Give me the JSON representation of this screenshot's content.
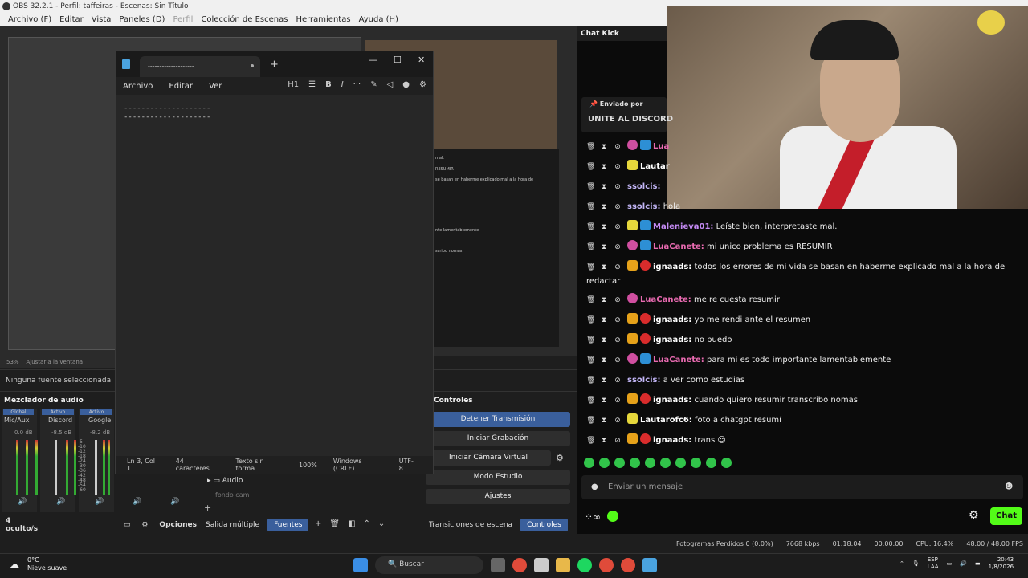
{
  "titlebar": {
    "title": "OBS 32.2.1 - Perfil: taffeiras - Escenas: Sin Título"
  },
  "menu": [
    "Archivo (F)",
    "Editar",
    "Vista",
    "Paneles (D)",
    "Perfil",
    "Colección de Escenas",
    "Herramientas",
    "Ayuda (H)"
  ],
  "notepad": {
    "tab_title": "--------------------",
    "menus": [
      "Archivo",
      "Editar",
      "Ver"
    ],
    "heading_label": "H1",
    "lines": [
      "--------------------",
      "--------------------"
    ],
    "status": [
      "Ln 3, Col 1",
      "44 caracteres.",
      "Texto sin forma",
      "100%",
      "Windows (CRLF)",
      "UTF-8"
    ]
  },
  "preview": {
    "zoom": "53%",
    "fit": "Ajustar a la ventana",
    "chat_lines": [
      "mal.",
      "RESUMIR",
      "se basan en haberme explicado mal a la hora de",
      "nte lamentablemente",
      "scribo nomas"
    ]
  },
  "sources": {
    "none_selected": "Ninguna fuente seleccionada"
  },
  "mixer": {
    "title": "Mezclador de audio",
    "channels": [
      {
        "status": "Global",
        "name": "Mic/Aux",
        "db": "0.0 dB"
      },
      {
        "status": "Activo",
        "name": "Discord",
        "db": "-8.5 dB"
      },
      {
        "status": "Activo",
        "name": "Google",
        "db": "-8.2 dB"
      }
    ],
    "scale": [
      "-5",
      "-10",
      "-12",
      "-18",
      "-24",
      "-30",
      "-36",
      "-42",
      "-48",
      "-54",
      "-60"
    ],
    "hidden": "4 oculto/s",
    "options": "Opciones",
    "sources_list": [
      "Audio",
      "fondo cam"
    ]
  },
  "controls": {
    "title": "Controles",
    "buttons": [
      "Detener Transmisión",
      "Iniciar Grabación",
      "Iniciar Cámara Virtual",
      "Modo Estudio",
      "Ajustes"
    ]
  },
  "dock_tabs": [
    "Salida múltiple",
    "Fuentes",
    "Transiciones de escena",
    "Controles"
  ],
  "chat": {
    "title": "Chat Kick",
    "pinned_by": "Enviado por",
    "pinned_msg": "UNITE AL DISCORD",
    "messages": [
      {
        "user": "Lua",
        "text": "",
        "color": "#e86ab0",
        "badges": [
          "b28",
          "bk"
        ]
      },
      {
        "user": "Lautar",
        "text": "",
        "color": "#ffffff",
        "badges": [
          "b15"
        ]
      },
      {
        "user": "ssolcis:",
        "text": "",
        "color": "#c3b6f7",
        "badges": []
      },
      {
        "user": "ssolcis:",
        "text": "hola",
        "color": "#c3b6f7",
        "badges": []
      },
      {
        "user": "Malenieva01:",
        "text": "Leíste bien, interpretaste mal.",
        "color": "#c58bf5",
        "badges": [
          "b15",
          "bk"
        ]
      },
      {
        "user": "LuaCanete:",
        "text": "mi unico problema es RESUMIR",
        "color": "#e86ab0",
        "badges": [
          "b28",
          "bk"
        ]
      },
      {
        "user": "ignaads:",
        "text": "todos los errores de mi vida se basan en haberme explicado mal a la hora de redactar",
        "color": "#ffffff",
        "badges": [
          "bcrown",
          "bred"
        ]
      },
      {
        "user": "LuaCanete:",
        "text": "me re cuesta resumir",
        "color": "#e86ab0",
        "badges": [
          "b28"
        ]
      },
      {
        "user": "ignaads:",
        "text": "yo me rendi ante el resumen",
        "color": "#ffffff",
        "badges": [
          "bcrown",
          "bred"
        ]
      },
      {
        "user": "ignaads:",
        "text": "no puedo",
        "color": "#ffffff",
        "badges": [
          "bcrown",
          "bred"
        ]
      },
      {
        "user": "LuaCanete:",
        "text": "para mi es todo importante lamentablemente",
        "color": "#e86ab0",
        "badges": [
          "b28",
          "bk"
        ]
      },
      {
        "user": "ssolcis:",
        "text": "a ver como estudias",
        "color": "#c3b6f7",
        "badges": []
      },
      {
        "user": "ignaads:",
        "text": "cuando quiero resumir transcribo nomas",
        "color": "#ffffff",
        "badges": [
          "bcrown",
          "bred"
        ]
      },
      {
        "user": "Lautarofc6:",
        "text": "foto a chatgpt resumí",
        "color": "#ffffff",
        "badges": [
          "b15"
        ]
      },
      {
        "user": "ignaads:",
        "text": "trans 😍",
        "color": "#ffffff",
        "badges": [
          "bcrown",
          "bred"
        ]
      }
    ],
    "input_placeholder": "Enviar un mensaje",
    "send_label": "Chat"
  },
  "obs_status": [
    "Fotogramas Perdidos 0 (0.0%)",
    "7668 kbps",
    "01:18:04",
    "00:00:00",
    "CPU: 16.4%",
    "48.00 / 48.00 FPS"
  ],
  "taskbar": {
    "temp": "0°C",
    "weather": "Nieve suave",
    "search": "Buscar",
    "lang": "ESP",
    "layout": "LAA",
    "time": "20:43",
    "date": "1/8/2026"
  }
}
